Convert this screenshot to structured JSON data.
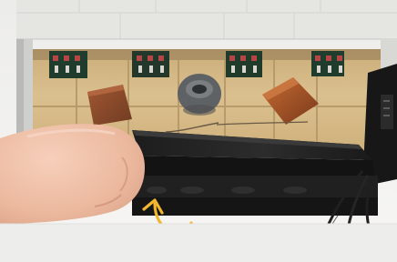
{
  "photo": {
    "subject": "",
    "printed_text": ""
  },
  "colors": {
    "background": "#f1f0ee",
    "wall_light": "#e7e7e4",
    "tan_floor": "#d7bc8a",
    "tan_shadow": "#b89b6a",
    "brown_tile": "#8c4a29",
    "orange_tile": "#9f4e25",
    "black_lever": "#232323",
    "dark_grey_part": "#666666",
    "arrow_yellow": "#f1b62d",
    "finger": "#efc0a8"
  },
  "icons": {
    "rotate_arrow": "curved-arrow-icon"
  }
}
